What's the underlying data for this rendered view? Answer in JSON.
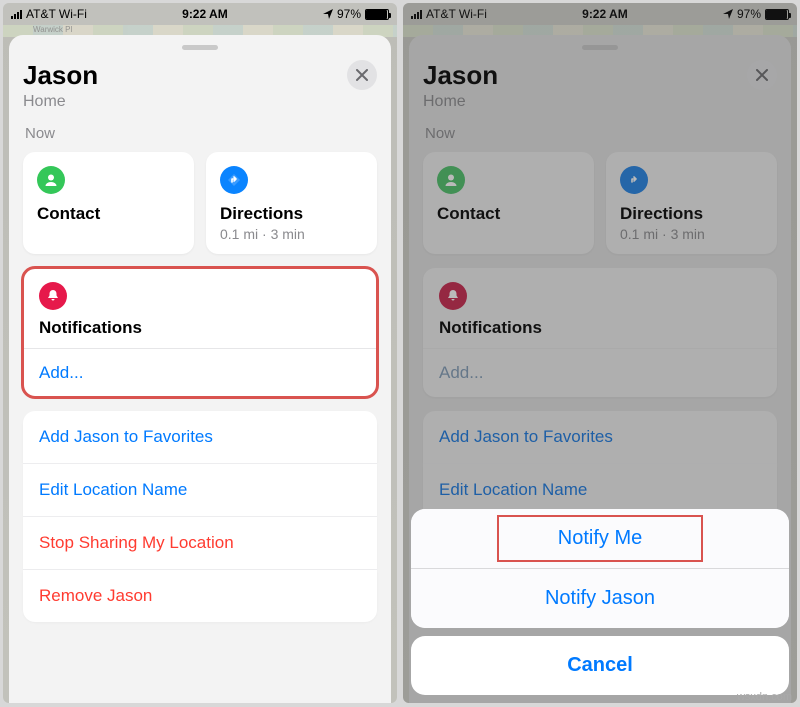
{
  "status": {
    "carrier": "AT&T Wi-Fi",
    "time": "9:22 AM",
    "battery_pct": "97%",
    "battery_fill": 97
  },
  "sheet": {
    "title": "Jason",
    "subtitle": "Home",
    "now_label": "Now"
  },
  "tiles": {
    "contact_label": "Contact",
    "directions_label": "Directions",
    "directions_meta": "0.1 mi · 3 min"
  },
  "notifications_card": {
    "label": "Notifications",
    "add_label": "Add..."
  },
  "list": {
    "add_favorites": "Add Jason to Favorites",
    "edit_location": "Edit Location Name",
    "stop_sharing": "Stop Sharing My Location",
    "remove": "Remove Jason"
  },
  "action_sheet": {
    "notify_me": "Notify Me",
    "notify_jason": "Notify Jason",
    "cancel": "Cancel"
  },
  "map_strip_label": "Warwick Pl",
  "watermark": "wsxdn.com"
}
